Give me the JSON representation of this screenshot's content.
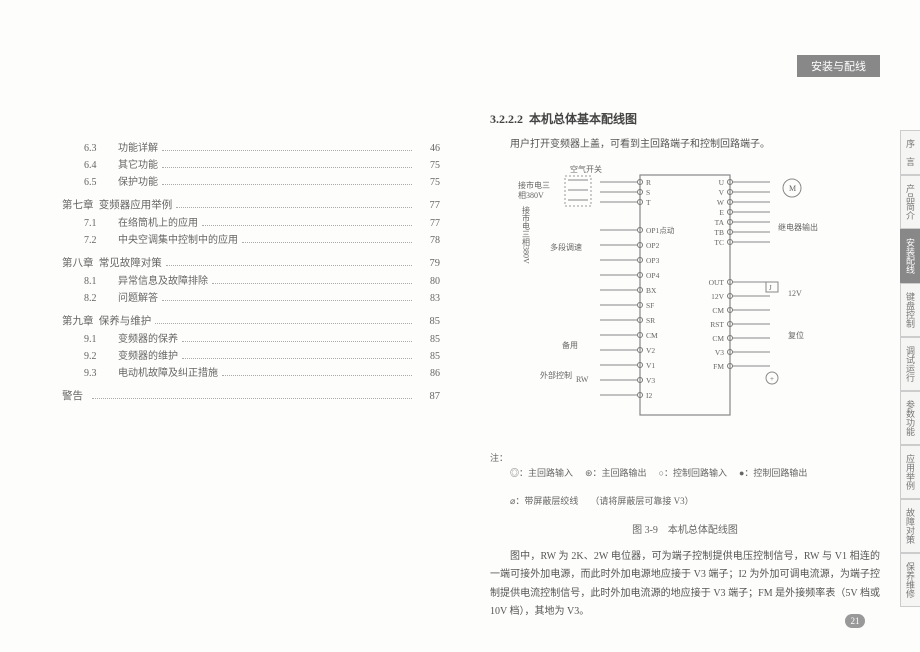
{
  "header_bar": "安装与配线",
  "toc": [
    {
      "type": "sub",
      "num": "6.3",
      "txt": "功能详解",
      "pg": "46"
    },
    {
      "type": "sub",
      "num": "6.4",
      "txt": "其它功能",
      "pg": "75"
    },
    {
      "type": "sub",
      "num": "6.5",
      "txt": "保护功能",
      "pg": "75"
    },
    {
      "type": "ch",
      "num": "第七章",
      "txt": "变频器应用举例",
      "pg": "77"
    },
    {
      "type": "sub",
      "num": "7.1",
      "txt": "在络筒机上的应用",
      "pg": "77"
    },
    {
      "type": "sub",
      "num": "7.2",
      "txt": "中央空调集中控制中的应用",
      "pg": "78"
    },
    {
      "type": "ch",
      "num": "第八章",
      "txt": "常见故障对策",
      "pg": "79"
    },
    {
      "type": "sub",
      "num": "8.1",
      "txt": "异常信息及故障排除",
      "pg": "80"
    },
    {
      "type": "sub",
      "num": "8.2",
      "txt": "问题解答",
      "pg": "83"
    },
    {
      "type": "ch",
      "num": "第九章",
      "txt": "保养与维护",
      "pg": "85"
    },
    {
      "type": "sub",
      "num": "9.1",
      "txt": "变频器的保养",
      "pg": "85"
    },
    {
      "type": "sub",
      "num": "9.2",
      "txt": "变频器的维护",
      "pg": "85"
    },
    {
      "type": "sub",
      "num": "9.3",
      "txt": "电动机故障及纠正措施",
      "pg": "86"
    },
    {
      "type": "ch",
      "num": "警告",
      "txt": "",
      "pg": "87"
    }
  ],
  "right": {
    "sec_num": "3.2.2.2",
    "sec_title": "本机总体基本配线图",
    "intro": "用户打开变频器上盖，可看到主回路端子和控制回路端子。",
    "diagram": {
      "air_switch": "空气开关",
      "power_label": "接市电三相380V",
      "main_in": [
        "R",
        "S",
        "T"
      ],
      "main_out": [
        "U",
        "V",
        "W",
        "E"
      ],
      "relay": [
        "TA",
        "TB",
        "TC"
      ],
      "relay_label": "继电器输出",
      "ctrl_in": [
        "OP1点动",
        "OP2",
        "OP3",
        "OP4",
        "BX",
        "SF",
        "SR",
        "CM",
        "V2",
        "V1",
        "V3",
        "I2"
      ],
      "ctrl_in_group_label": "多段调速",
      "backup_label": "备用",
      "ext_ctrl_label": "外部控制",
      "rw_label": "RW",
      "ctrl_out": [
        "OUT",
        "12V",
        "CM",
        "RST",
        "CM",
        "V3",
        "FM"
      ],
      "out12v_label": "12V",
      "reset_label": "复位",
      "motor_symbol": "M",
      "meter_symbol": "+",
      "jumper_symbol": "J"
    },
    "legend_title": "注：",
    "legend": [
      "◎：主回路输入",
      "⊛：主回路输出",
      "○：控制回路输入",
      "●：控制回路输出",
      "⌀：带屏蔽层绞线",
      "（请将屏蔽层可靠接 V3）"
    ],
    "caption": "图 3-9　本机总体配线图",
    "body": "图中，RW 为 2K、2W 电位器，可为端子控制提供电压控制信号，RW 与 V1 相连的一端可接外加电源，而此时外加电源地应接于 V3 端子；I2 为外加可调电流源，为端子控制提供电流控制信号，此时外加电流源的地应接于 V3 端子；FM 是外接频率表（5V 档或 10V 档），其地为 V3。",
    "page_number": "21"
  },
  "side_tabs": [
    "序　言",
    "产品简介",
    "安装配线",
    "键盘控制",
    "调试运行",
    "参数功能",
    "应用举例",
    "故障对策",
    "保养维修"
  ],
  "active_tab_index": 2
}
